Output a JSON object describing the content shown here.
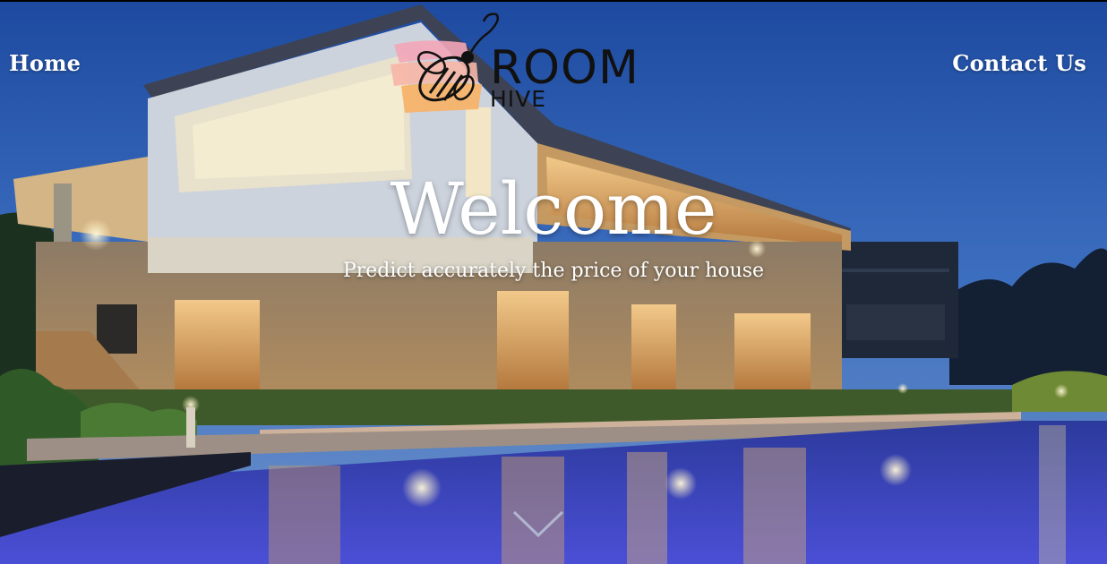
{
  "nav": {
    "home_label": "Home",
    "contact_label": "Contact Us"
  },
  "logo": {
    "word_top": "ROOM",
    "word_bottom": "HIVE",
    "icon": "bee-icon"
  },
  "hero": {
    "title": "Welcome",
    "subtitle": "Predict accurately the price of your house",
    "background": "house-with-pool-photo",
    "scroll_icon": "chevron-down-icon"
  },
  "colors": {
    "sky": "#2f5fae",
    "text": "#ffffff",
    "logo_pink": "#f3a6b8",
    "logo_orange": "#f7b267",
    "pool": "#3a4fc9"
  }
}
